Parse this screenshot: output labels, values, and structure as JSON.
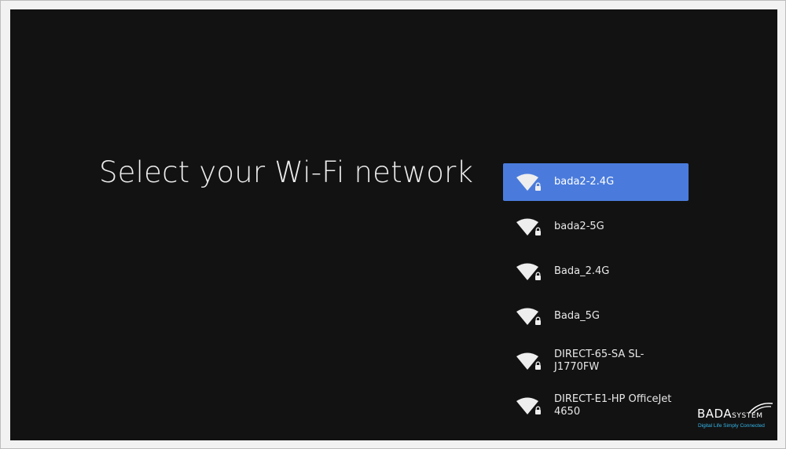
{
  "title": "Select your Wi-Fi network",
  "networks": [
    {
      "ssid": "bada2-2.4G",
      "secured": true,
      "selected": true
    },
    {
      "ssid": "bada2-5G",
      "secured": true,
      "selected": false
    },
    {
      "ssid": "Bada_2.4G",
      "secured": true,
      "selected": false
    },
    {
      "ssid": "Bada_5G",
      "secured": true,
      "selected": false
    },
    {
      "ssid": "DIRECT-65-SA SL-J1770FW",
      "secured": true,
      "selected": false
    },
    {
      "ssid": "DIRECT-E1-HP OfficeJet 4650",
      "secured": true,
      "selected": false
    }
  ],
  "icons": {
    "network": "wifi-lock-icon"
  },
  "watermark": {
    "brand": "BADA",
    "brand_suffix": "SYSTEM",
    "tagline": "Digital Life Simply Connected"
  },
  "colors": {
    "background": "#121212",
    "selected": "#4a7bdc",
    "tagline": "#36b7ea"
  }
}
